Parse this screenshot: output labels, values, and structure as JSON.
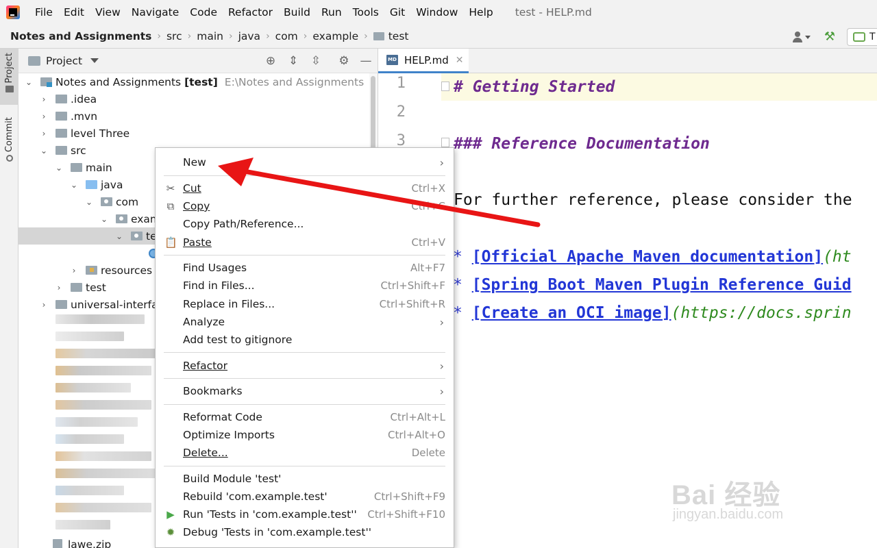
{
  "menubar": {
    "items": [
      "File",
      "Edit",
      "View",
      "Navigate",
      "Code",
      "Refactor",
      "Build",
      "Run",
      "Tools",
      "Git",
      "Window",
      "Help"
    ],
    "window_title": "test - HELP.md"
  },
  "breadcrumb": {
    "items": [
      "Notes and Assignments",
      "src",
      "main",
      "java",
      "com",
      "example",
      "test"
    ],
    "run_config_label": "T"
  },
  "tool_strip": {
    "project": "Project",
    "commit": "Commit"
  },
  "project_panel": {
    "title": "Project",
    "tree": [
      {
        "label": "Notes and Assignments",
        "bold_suffix": "[test]",
        "path": "E:\\Notes and Assignments"
      },
      {
        "label": ".idea"
      },
      {
        "label": ".mvn"
      },
      {
        "label": "level Three"
      },
      {
        "label": "src"
      },
      {
        "label": "main"
      },
      {
        "label": "java"
      },
      {
        "label": "com"
      },
      {
        "label": "exam"
      },
      {
        "label": "te"
      },
      {
        "label": ""
      },
      {
        "label": "resources"
      },
      {
        "label": "test"
      },
      {
        "label": "universal-interfac"
      },
      {
        "label": "lawe.zip"
      }
    ]
  },
  "editor": {
    "tab_label": "HELP.md",
    "tab_icon_text": "MD",
    "line_numbers": [
      "1",
      "2",
      "3"
    ],
    "lines": {
      "l1": "# Getting Started",
      "l3": "### Reference Documentation",
      "l5": "For further reference, please consider the",
      "b1_star": "*",
      "b1_link": "[Official Apache Maven documentation]",
      "b1_paren": "(ht",
      "b2_star": "*",
      "b2_link": "[Spring Boot Maven Plugin Reference Guid",
      "b3_star": "*",
      "b3_link": "[Create an OCI image]",
      "b3_paren": "(https://docs.sprin"
    }
  },
  "context_menu": {
    "new": "New",
    "cut": "Cut",
    "cut_short": "Ctrl+X",
    "copy": "Copy",
    "copy_short": "Ctrl+C",
    "copy_path": "Copy Path/Reference...",
    "paste": "Paste",
    "paste_short": "Ctrl+V",
    "find_usages": "Find Usages",
    "find_usages_short": "Alt+F7",
    "find_in_files": "Find in Files...",
    "find_in_files_short": "Ctrl+Shift+F",
    "replace_in_files": "Replace in Files...",
    "replace_in_files_short": "Ctrl+Shift+R",
    "analyze": "Analyze",
    "add_gitignore": "Add test to gitignore",
    "refactor": "Refactor",
    "bookmarks": "Bookmarks",
    "reformat": "Reformat Code",
    "reformat_short": "Ctrl+Alt+L",
    "optimize": "Optimize Imports",
    "optimize_short": "Ctrl+Alt+O",
    "delete": "Delete...",
    "delete_short": "Delete",
    "build_module": "Build Module 'test'",
    "rebuild": "Rebuild 'com.example.test'",
    "rebuild_short": "Ctrl+Shift+F9",
    "run_tests": "Run 'Tests in 'com.example.test''",
    "run_tests_short": "Ctrl+Shift+F10",
    "debug_tests": "Debug 'Tests in 'com.example.test''"
  },
  "watermark": {
    "logo": "Bai 经验",
    "sub": "jingyan.baidu.com"
  },
  "colors": {
    "annotation_arrow": "#e81515",
    "heading": "#6e2a8f",
    "link": "#2236d6",
    "selection": "#d5d5d5"
  }
}
